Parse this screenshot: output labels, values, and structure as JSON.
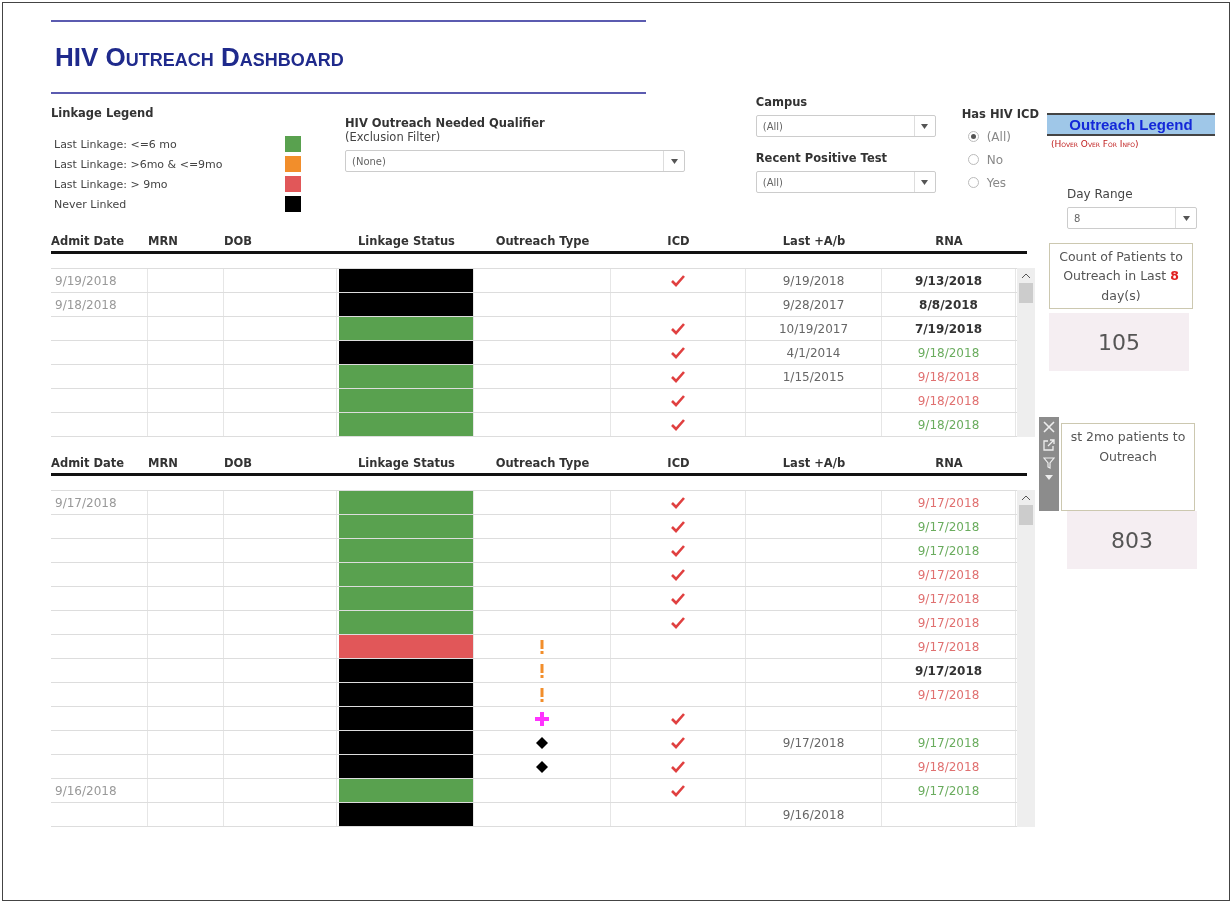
{
  "title": "HIV Outreach Dashboard",
  "linkage_legend": {
    "title": "Linkage Legend",
    "items": [
      {
        "label": "Last Linkage: <=6 mo",
        "color": "#59a14f"
      },
      {
        "label": "Last Linkage: >6mo & <=9mo",
        "color": "#f28e2b"
      },
      {
        "label": "Last Linkage: > 9mo",
        "color": "#e15759"
      },
      {
        "label": "Never Linked",
        "color": "#000000"
      }
    ]
  },
  "qualifier": {
    "label": "HIV Outreach Needed Qualifier",
    "sublabel": "(Exclusion Filter)",
    "value": "(None)"
  },
  "campus": {
    "label": "Campus",
    "value": "(All)"
  },
  "recent_positive_test": {
    "label": "Recent Positive Test",
    "value": "(All)"
  },
  "has_hiv_icd": {
    "label": "Has HIV ICD",
    "options": [
      {
        "label": "(All)",
        "selected": true
      },
      {
        "label": "No",
        "selected": false
      },
      {
        "label": "Yes",
        "selected": false
      }
    ]
  },
  "outreach_legend": {
    "label": "Outreach Legend",
    "hint": "(Hover Over For Info)"
  },
  "day_range": {
    "label": "Day Range",
    "value": "8"
  },
  "tables": [
    {
      "columns": [
        "Admit Date",
        "MRN",
        "DOB",
        "Linkage Status",
        "Outreach Type",
        "ICD",
        "Last +A/b",
        "RNA"
      ],
      "rows": [
        {
          "admit_date": "9/19/2018",
          "color": "#000000",
          "icd": true,
          "last_ab": "9/19/2018",
          "rna": {
            "date": "9/13/2018",
            "color": "#333333"
          }
        },
        {
          "admit_date": "9/18/2018",
          "color": "#000000",
          "icd": false,
          "last_ab": "9/28/2017",
          "rna": {
            "date": "8/8/2018",
            "color": "#333333"
          }
        },
        {
          "color": "#59a14f",
          "icd": true,
          "last_ab": "10/19/2017",
          "rna": {
            "date": "7/19/2018",
            "color": "#333333"
          }
        },
        {
          "color": "#000000",
          "icd": true,
          "last_ab": "4/1/2014",
          "rna": {
            "date": "9/18/2018",
            "color": "#6aac5e"
          }
        },
        {
          "color": "#59a14f",
          "icd": true,
          "last_ab": "1/15/2015",
          "rna": {
            "date": "9/18/2018",
            "color": "#e07070"
          }
        },
        {
          "color": "#59a14f",
          "icd": true,
          "rna": {
            "date": "9/18/2018",
            "color": "#e07070"
          }
        },
        {
          "color": "#59a14f",
          "icd": true,
          "rna": {
            "date": "9/18/2018",
            "color": "#6aac5e"
          }
        }
      ]
    },
    {
      "columns": [
        "Admit Date",
        "MRN",
        "DOB",
        "Linkage Status",
        "Outreach Type",
        "ICD",
        "Last +A/b",
        "RNA"
      ],
      "rows": [
        {
          "admit_date": "9/17/2018",
          "color": "#59a14f",
          "icd": true,
          "rna": {
            "date": "9/17/2018",
            "color": "#e07070"
          }
        },
        {
          "color": "#59a14f",
          "icd": true,
          "rna": {
            "date": "9/17/2018",
            "color": "#6aac5e"
          }
        },
        {
          "color": "#59a14f",
          "icd": true,
          "rna": {
            "date": "9/17/2018",
            "color": "#6aac5e"
          }
        },
        {
          "color": "#59a14f",
          "icd": true,
          "rna": {
            "date": "9/17/2018",
            "color": "#e07070"
          }
        },
        {
          "color": "#59a14f",
          "icd": true,
          "rna": {
            "date": "9/17/2018",
            "color": "#e07070"
          }
        },
        {
          "color": "#59a14f",
          "icd": true,
          "rna": {
            "date": "9/17/2018",
            "color": "#e07070"
          }
        },
        {
          "color": "#e15759",
          "outreach": {
            "kind": "exclamation"
          },
          "icd": false,
          "rna": {
            "date": "9/17/2018",
            "color": "#e07070"
          }
        },
        {
          "color": "#000000",
          "outreach": {
            "kind": "exclamation"
          },
          "icd": false,
          "rna": {
            "date": "9/17/2018",
            "color": "#333333"
          }
        },
        {
          "color": "#000000",
          "outreach": {
            "kind": "exclamation"
          },
          "icd": false,
          "rna": {
            "date": "9/17/2018",
            "color": "#e07070"
          }
        },
        {
          "color": "#000000",
          "outreach": {
            "kind": "plus"
          },
          "icd": true
        },
        {
          "color": "#000000",
          "outreach": {
            "kind": "diamond"
          },
          "icd": true,
          "last_ab": "9/17/2018",
          "rna": {
            "date": "9/17/2018",
            "color": "#6aac5e"
          }
        },
        {
          "color": "#000000",
          "outreach": {
            "kind": "diamond"
          },
          "icd": true,
          "rna": {
            "date": "9/18/2018",
            "color": "#e07070"
          }
        },
        {
          "admit_date": "9/16/2018",
          "color": "#59a14f",
          "icd": true,
          "rna": {
            "date": "9/17/2018",
            "color": "#6aac5e"
          }
        },
        {
          "color": "#000000",
          "icd": false,
          "last_ab": "9/16/2018"
        }
      ]
    }
  ],
  "count_cards": [
    {
      "caption": "Count of Patients to Outreach in Last **8** day(s)",
      "value": "105"
    },
    {
      "caption": "st 2mo patients to Outreach",
      "value": "803"
    }
  ]
}
